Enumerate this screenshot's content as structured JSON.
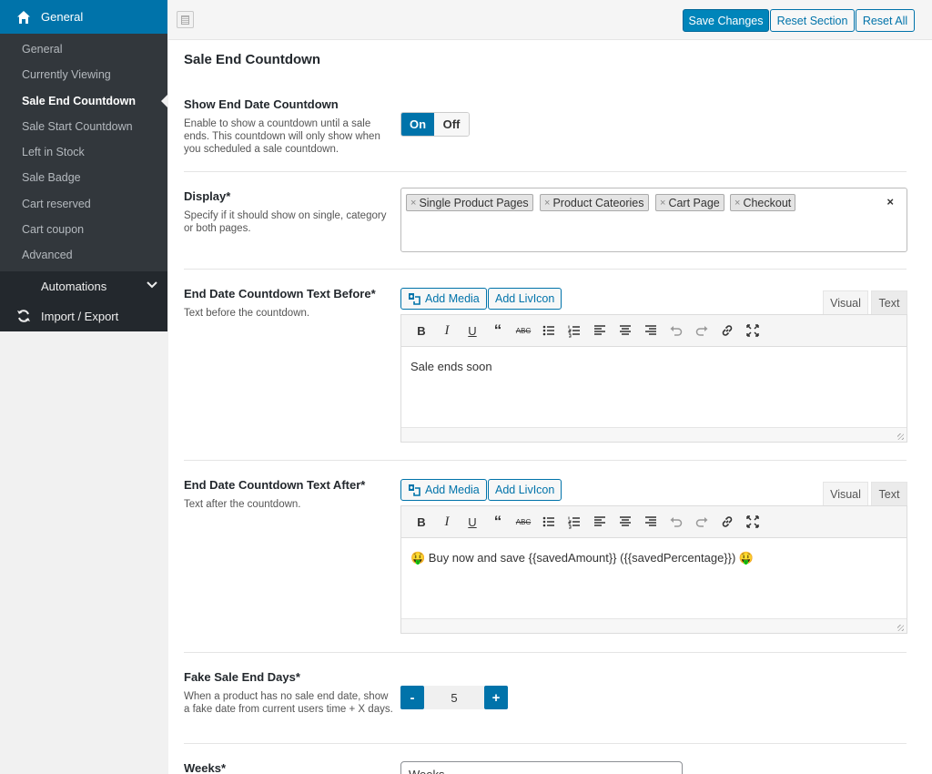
{
  "sidebar": {
    "header": "General",
    "items": [
      {
        "label": "General"
      },
      {
        "label": "Currently Viewing"
      },
      {
        "label": "Sale End Countdown"
      },
      {
        "label": "Sale Start Countdown"
      },
      {
        "label": "Left in Stock"
      },
      {
        "label": "Sale Badge"
      },
      {
        "label": "Cart reserved"
      },
      {
        "label": "Cart coupon"
      },
      {
        "label": "Advanced"
      }
    ],
    "active_item": "Sale End Countdown",
    "automations": "Automations",
    "import_export": "Import / Export"
  },
  "toolbar": {
    "save": "Save Changes",
    "reset_section": "Reset Section",
    "reset_all": "Reset All"
  },
  "section_title": "Sale End Countdown",
  "fields": {
    "show_end": {
      "label": "Show End Date Countdown",
      "desc": "Enable to show a countdown until a sale ends. This countdown will only show when you scheduled a sale countdown.",
      "on": "On",
      "off": "Off",
      "value": "On"
    },
    "display": {
      "label": "Display*",
      "desc": "Specify if it should show on single, category or both pages.",
      "tags": [
        "Single Product Pages",
        "Product Cateories",
        "Cart Page",
        "Checkout"
      ],
      "tag_remove": "×",
      "clear": "×"
    },
    "text_before": {
      "label": "End Date Countdown Text Before*",
      "desc": "Text before the countdown.",
      "add_media": "Add Media",
      "add_livicon": "Add LivIcon",
      "tab_visual": "Visual",
      "tab_text": "Text",
      "content": "Sale ends soon"
    },
    "text_after": {
      "label": "End Date Countdown Text After*",
      "desc": "Text after the countdown.",
      "add_media": "Add Media",
      "add_livicon": "Add LivIcon",
      "tab_visual": "Visual",
      "tab_text": "Text",
      "content": "🤑 Buy now and save {{savedAmount}} ({{savedPercentage}}) 🤑"
    },
    "fake_days": {
      "label": "Fake Sale End Days*",
      "desc": "When a product has no sale end date, show a fake date from current users time + X days.",
      "minus": "-",
      "plus": "+",
      "value": "5"
    },
    "weeks": {
      "label": "Weeks*",
      "value": "Weeks"
    }
  },
  "colors": {
    "accent": "#0073aa",
    "sidebar_bg": "#23282d",
    "sidebar_sub_bg": "#32373c"
  }
}
